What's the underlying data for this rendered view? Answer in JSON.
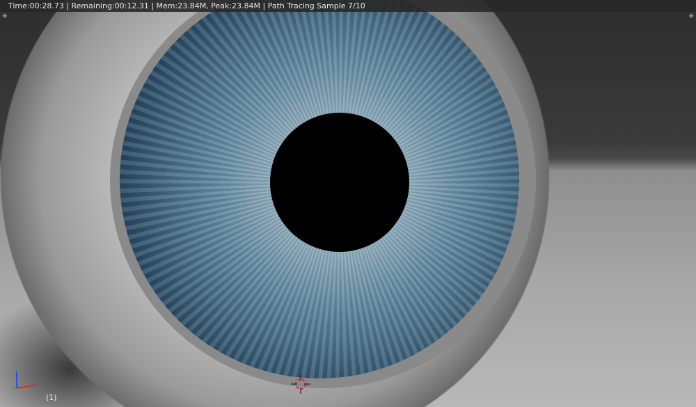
{
  "header": {
    "render_stats": "Time:00:28.73 | Remaining:00:12.31 | Mem:23.84M, Peak:23.84M | Path Tracing Sample 7/10"
  },
  "viewport": {
    "frame_label": "(1)"
  },
  "icons": {
    "corner_widget": "plus-icon",
    "cursor": "3d-cursor-icon",
    "axes": "axis-gizmo-icon"
  },
  "colors": {
    "x_axis": "#d03030",
    "y_axis": "#30b030",
    "z_axis": "#3050d0",
    "cursor_red": "#e02020"
  }
}
